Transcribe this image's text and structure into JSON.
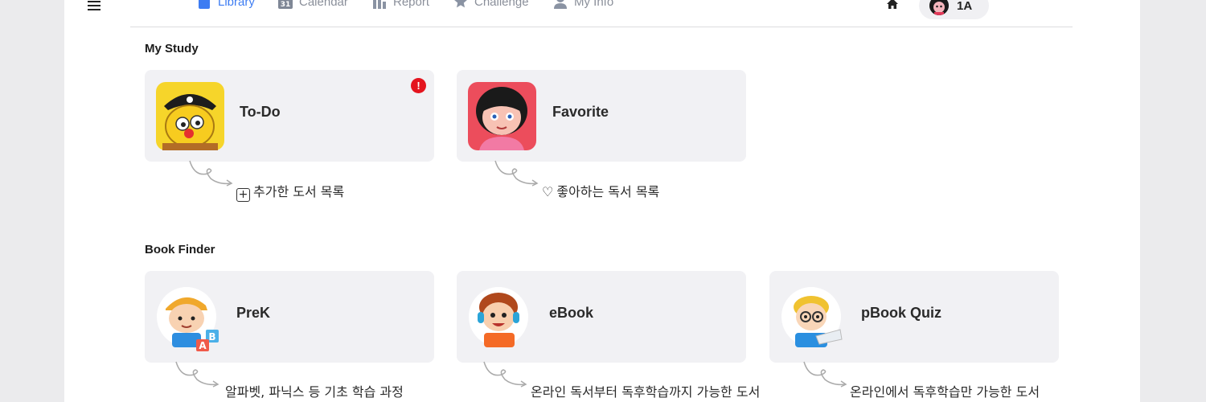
{
  "nav": {
    "items": [
      {
        "label": "Library",
        "icon": "book-icon",
        "active": true
      },
      {
        "label": "Calendar",
        "icon": "calendar-icon",
        "badge": "31"
      },
      {
        "label": "Report",
        "icon": "bar-chart-icon"
      },
      {
        "label": "Challenge",
        "icon": "star-icon"
      },
      {
        "label": "My Info",
        "icon": "person-icon"
      }
    ]
  },
  "user": {
    "label": "1A"
  },
  "my_study": {
    "title": "My Study",
    "cards": [
      {
        "label": "To-Do",
        "caption_icon": "+",
        "caption": "추가한 도서 목록",
        "alert": "!"
      },
      {
        "label": "Favorite",
        "caption_icon": "♡",
        "caption": "좋아하는 독서 목록"
      }
    ]
  },
  "book_finder": {
    "title": "Book Finder",
    "cards": [
      {
        "label": "PreK",
        "caption": "알파벳, 파닉스 등 기초 학습 과정"
      },
      {
        "label": "eBook",
        "caption": "온라인 독서부터 독후학습까지 가능한 도서"
      },
      {
        "label": "pBook Quiz",
        "caption": "온라인에서 독후학습만 가능한 도서"
      }
    ]
  },
  "colors": {
    "accent": "#3d7cf2",
    "card_bg": "#f1f1f4",
    "alert": "#e4141e"
  }
}
